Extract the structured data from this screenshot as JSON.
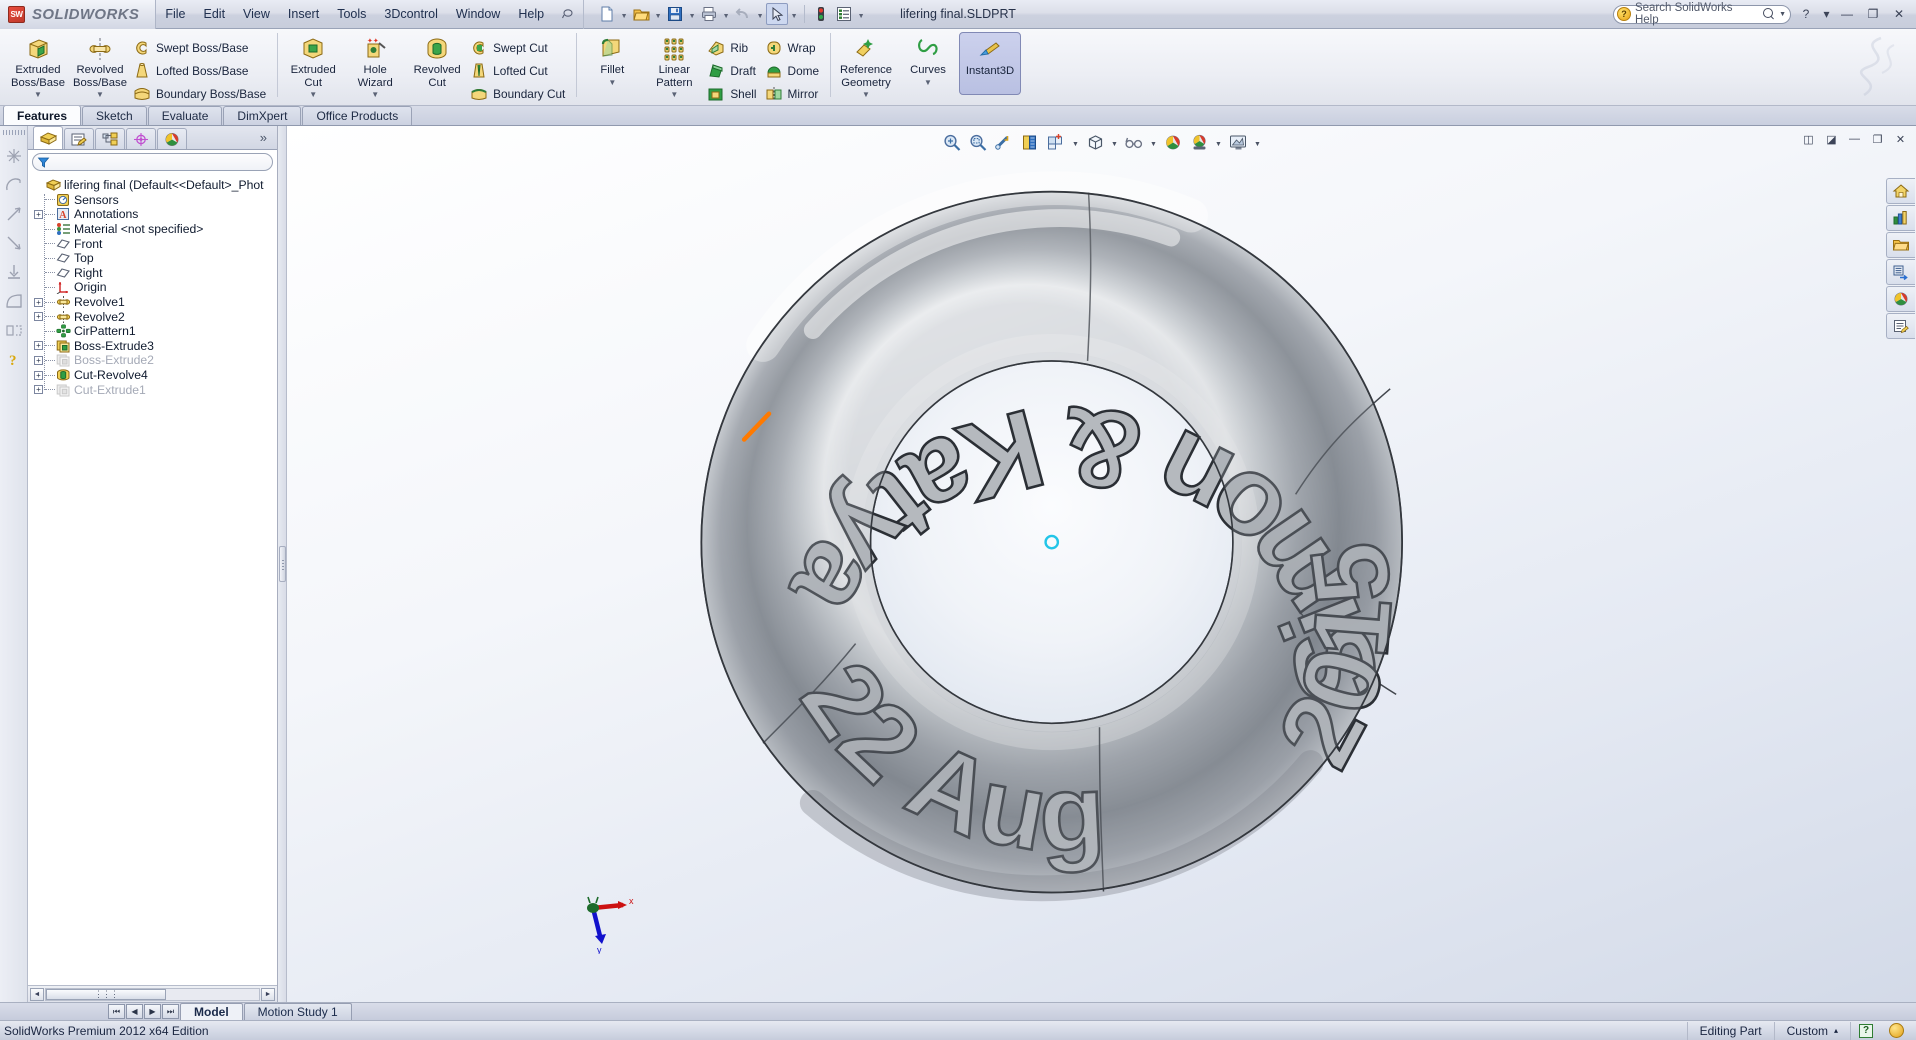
{
  "app": {
    "brand": "SOLIDWORKS",
    "brand_badge": "SW",
    "document_title": "lifering final.SLDPRT",
    "edition": "SolidWorks Premium 2012 x64 Edition"
  },
  "menu": {
    "items": [
      "File",
      "Edit",
      "View",
      "Insert",
      "Tools",
      "3Dcontrol",
      "Window",
      "Help"
    ],
    "pin_icon": "pushpin-icon"
  },
  "quick_access": [
    {
      "name": "new-document-button",
      "icon": "new-document-icon",
      "caret": true
    },
    {
      "name": "open-document-button",
      "icon": "open-folder-icon",
      "caret": true
    },
    {
      "name": "save-button",
      "icon": "floppy-disk-icon",
      "caret": true
    },
    {
      "name": "print-button",
      "icon": "printer-icon",
      "caret": true
    },
    {
      "name": "undo-button",
      "icon": "undo-arrow-icon",
      "caret": true
    },
    {
      "name": "select-button",
      "icon": "cursor-arrow-icon",
      "caret": true,
      "pressed": true
    },
    {
      "name": "rebuild-button",
      "icon": "traffic-light-icon",
      "caret": false
    },
    {
      "name": "options-button",
      "icon": "options-list-icon",
      "caret": true
    }
  ],
  "search": {
    "placeholder": "Search SolidWorks Help",
    "value": "",
    "help_icon": "help-bulb-icon",
    "magnifier_icon": "search-icon"
  },
  "window_controls": [
    {
      "name": "help-button",
      "glyph": "?"
    },
    {
      "name": "help-dropdown",
      "glyph": "▾"
    },
    {
      "name": "minimize-button",
      "glyph": "—"
    },
    {
      "name": "restore-button",
      "glyph": "❐"
    },
    {
      "name": "close-button",
      "glyph": "✕"
    }
  ],
  "document_window_controls": [
    {
      "name": "doc-tile-left-button",
      "glyph": "◫"
    },
    {
      "name": "doc-tile-right-button",
      "glyph": "◪"
    },
    {
      "name": "doc-minimize-button",
      "glyph": "—"
    },
    {
      "name": "doc-restore-button",
      "glyph": "❐"
    },
    {
      "name": "doc-close-button",
      "glyph": "✕"
    }
  ],
  "ribbon": {
    "groups": [
      {
        "name": "boss-base-group",
        "big": [
          {
            "name": "extruded-boss-base-button",
            "label": "Extruded\nBoss/Base",
            "icon": "extruded-boss-icon",
            "caret": true
          },
          {
            "name": "revolved-boss-base-button",
            "label": "Revolved\nBoss/Base",
            "icon": "revolved-boss-icon",
            "caret": true
          }
        ],
        "small": [
          {
            "name": "swept-boss-base-button",
            "label": "Swept Boss/Base",
            "icon": "swept-boss-icon"
          },
          {
            "name": "lofted-boss-base-button",
            "label": "Lofted Boss/Base",
            "icon": "lofted-boss-icon"
          },
          {
            "name": "boundary-boss-base-button",
            "label": "Boundary Boss/Base",
            "icon": "boundary-boss-icon"
          }
        ]
      },
      {
        "name": "cut-group",
        "big": [
          {
            "name": "extruded-cut-button",
            "label": "Extruded\nCut",
            "icon": "extruded-cut-icon",
            "caret": true
          },
          {
            "name": "hole-wizard-button",
            "label": "Hole\nWizard",
            "icon": "hole-wizard-icon",
            "caret": true
          },
          {
            "name": "revolved-cut-button",
            "label": "Revolved\nCut",
            "icon": "revolved-cut-icon",
            "caret": false
          }
        ],
        "small": [
          {
            "name": "swept-cut-button",
            "label": "Swept Cut",
            "icon": "swept-cut-icon"
          },
          {
            "name": "lofted-cut-button",
            "label": "Lofted Cut",
            "icon": "lofted-cut-icon"
          },
          {
            "name": "boundary-cut-button",
            "label": "Boundary Cut",
            "icon": "boundary-cut-icon"
          }
        ]
      },
      {
        "name": "features-group",
        "big": [
          {
            "name": "fillet-button",
            "label": "Fillet",
            "icon": "fillet-icon",
            "caret": true
          },
          {
            "name": "linear-pattern-button",
            "label": "Linear\nPattern",
            "icon": "linear-pattern-icon",
            "caret": true
          }
        ],
        "small": [
          {
            "name": "rib-button",
            "label": "Rib",
            "icon": "rib-icon"
          },
          {
            "name": "draft-button",
            "label": "Draft",
            "icon": "draft-icon"
          },
          {
            "name": "shell-button",
            "label": "Shell",
            "icon": "shell-icon"
          }
        ],
        "small2": [
          {
            "name": "wrap-button",
            "label": "Wrap",
            "icon": "wrap-icon"
          },
          {
            "name": "dome-button",
            "label": "Dome",
            "icon": "dome-icon"
          },
          {
            "name": "mirror-button",
            "label": "Mirror",
            "icon": "mirror-icon"
          }
        ]
      },
      {
        "name": "reference-group",
        "big": [
          {
            "name": "reference-geometry-button",
            "label": "Reference\nGeometry",
            "icon": "reference-geometry-icon",
            "caret": true
          },
          {
            "name": "curves-button",
            "label": "Curves",
            "icon": "curves-icon",
            "caret": true
          },
          {
            "name": "instant3d-button",
            "label": "Instant3D",
            "icon": "instant3d-icon",
            "caret": false,
            "active": true
          }
        ]
      }
    ]
  },
  "command_tabs": [
    {
      "name": "tab-features",
      "label": "Features",
      "active": true
    },
    {
      "name": "tab-sketch",
      "label": "Sketch",
      "active": false
    },
    {
      "name": "tab-evaluate",
      "label": "Evaluate",
      "active": false
    },
    {
      "name": "tab-dimxpert",
      "label": "DimXpert",
      "active": false
    },
    {
      "name": "tab-office-products",
      "label": "Office Products",
      "active": false
    }
  ],
  "left_toolbar": [
    {
      "name": "sketch-point-icon"
    },
    {
      "name": "sketch-arc-icon"
    },
    {
      "name": "sketch-line-icon"
    },
    {
      "name": "sketch-trim-icon"
    },
    {
      "name": "sketch-dimension-icon"
    },
    {
      "name": "sketch-fillet-icon"
    },
    {
      "name": "sketch-mirror-icon"
    },
    {
      "name": "help-question-icon"
    }
  ],
  "feature_manager": {
    "tabs": [
      {
        "name": "featuremanager-design-tree-tab",
        "icon": "feature-tree-icon",
        "active": true
      },
      {
        "name": "property-manager-tab",
        "icon": "property-manager-icon",
        "active": false
      },
      {
        "name": "configuration-manager-tab",
        "icon": "configuration-manager-icon",
        "active": false
      },
      {
        "name": "dimxpert-manager-tab",
        "icon": "dimxpert-target-icon",
        "active": false
      },
      {
        "name": "display-manager-tab",
        "icon": "display-manager-sphere-icon",
        "active": false
      }
    ],
    "more_glyph": "»",
    "filter": {
      "name": "filter-input",
      "placeholder": "",
      "value": "",
      "icon": "funnel-icon"
    },
    "tree": [
      {
        "name": "tree-item-root",
        "label": "lifering final  (Default<<Default>_Phot",
        "icon": "part-icon",
        "expand": "none",
        "suppressed": false,
        "indent": 0
      },
      {
        "name": "tree-item-sensors",
        "label": "Sensors",
        "icon": "sensors-icon",
        "expand": "none",
        "suppressed": false,
        "indent": 1
      },
      {
        "name": "tree-item-annotations",
        "label": "Annotations",
        "icon": "annotations-icon",
        "expand": "plus",
        "suppressed": false,
        "indent": 1
      },
      {
        "name": "tree-item-material",
        "label": "Material <not specified>",
        "icon": "material-icon",
        "expand": "none",
        "suppressed": false,
        "indent": 1
      },
      {
        "name": "tree-item-front-plane",
        "label": "Front",
        "icon": "plane-icon",
        "expand": "none",
        "suppressed": false,
        "indent": 1
      },
      {
        "name": "tree-item-top-plane",
        "label": "Top",
        "icon": "plane-icon",
        "expand": "none",
        "suppressed": false,
        "indent": 1
      },
      {
        "name": "tree-item-right-plane",
        "label": "Right",
        "icon": "plane-icon",
        "expand": "none",
        "suppressed": false,
        "indent": 1
      },
      {
        "name": "tree-item-origin",
        "label": "Origin",
        "icon": "origin-icon",
        "expand": "none",
        "suppressed": false,
        "indent": 1
      },
      {
        "name": "tree-item-revolve1",
        "label": "Revolve1",
        "icon": "revolve-icon",
        "expand": "plus",
        "suppressed": false,
        "indent": 1
      },
      {
        "name": "tree-item-revolve2",
        "label": "Revolve2",
        "icon": "revolve-icon",
        "expand": "plus",
        "suppressed": false,
        "indent": 1
      },
      {
        "name": "tree-item-cirpattern1",
        "label": "CirPattern1",
        "icon": "circular-pattern-icon",
        "expand": "none",
        "suppressed": false,
        "indent": 1
      },
      {
        "name": "tree-item-boss-extrude3",
        "label": "Boss-Extrude3",
        "icon": "boss-extrude-icon",
        "expand": "plus",
        "suppressed": false,
        "indent": 1
      },
      {
        "name": "tree-item-boss-extrude2",
        "label": "Boss-Extrude2",
        "icon": "boss-extrude-icon",
        "expand": "plus",
        "suppressed": true,
        "indent": 1
      },
      {
        "name": "tree-item-cut-revolve4",
        "label": "Cut-Revolve4",
        "icon": "cut-revolve-icon",
        "expand": "plus",
        "suppressed": false,
        "indent": 1
      },
      {
        "name": "tree-item-cut-extrude1",
        "label": "Cut-Extrude1",
        "icon": "cut-extrude-icon",
        "expand": "plus",
        "suppressed": true,
        "indent": 1
      }
    ],
    "hscroll": {
      "name": "feature-tree-hscrollbar",
      "left_glyph": "◄",
      "right_glyph": "►",
      "thumb_glyph": "⋮⋮⋮"
    }
  },
  "view_toolbar": [
    {
      "name": "zoom-to-fit-button",
      "icon": "zoom-fit-icon",
      "caret": false
    },
    {
      "name": "zoom-to-area-button",
      "icon": "zoom-area-icon",
      "caret": false
    },
    {
      "name": "previous-view-button",
      "icon": "previous-view-icon",
      "caret": false
    },
    {
      "name": "section-view-button",
      "icon": "section-view-icon",
      "caret": false
    },
    {
      "name": "view-orientation-button",
      "icon": "view-orientation-icon",
      "caret": true
    },
    {
      "name": "display-style-button",
      "icon": "display-style-cube-icon",
      "caret": true
    },
    {
      "name": "hide-show-items-button",
      "icon": "glasses-icon",
      "caret": true
    },
    {
      "name": "edit-appearance-button",
      "icon": "appearance-sphere-icon",
      "caret": false
    },
    {
      "name": "apply-scene-button",
      "icon": "scene-sphere-icon",
      "caret": true
    },
    {
      "name": "view-settings-button",
      "icon": "view-settings-monitor-icon",
      "caret": true
    }
  ],
  "task_pane": [
    {
      "name": "solidworks-resources-button",
      "icon": "home-icon"
    },
    {
      "name": "design-library-button",
      "icon": "design-library-icon"
    },
    {
      "name": "file-explorer-button",
      "icon": "folder-icon"
    },
    {
      "name": "view-palette-button",
      "icon": "view-palette-icon"
    },
    {
      "name": "appearances-scenes-button",
      "icon": "appearances-sphere-icon"
    },
    {
      "name": "custom-properties-button",
      "icon": "custom-properties-icon"
    }
  ],
  "model": {
    "name": "lifering-torus-model",
    "engraved_text": [
      "Simon & Katya",
      "22 Aug",
      "2015"
    ],
    "highlight_color": "#ff7a00",
    "origin_marker_color": "#22c5e8",
    "triad": {
      "name": "coordinate-triad",
      "x_label": "x",
      "y_label": "y",
      "x_color": "#cc1111",
      "y_color": "#1111cc",
      "z_color": "#117711"
    }
  },
  "document_tabs": {
    "nav": [
      "⏮",
      "◀",
      "▶",
      "⏭"
    ],
    "tabs": [
      {
        "name": "tab-model",
        "label": "Model",
        "active": true
      },
      {
        "name": "tab-motion-study-1",
        "label": "Motion Study 1",
        "active": false
      }
    ]
  },
  "status_bar": {
    "left": "SolidWorks Premium 2012 x64 Edition",
    "editing_state": "Editing Part",
    "units": "Custom",
    "units_caret": "▴",
    "help_glyph": "?",
    "egg_icon": "sw-coin-icon"
  }
}
